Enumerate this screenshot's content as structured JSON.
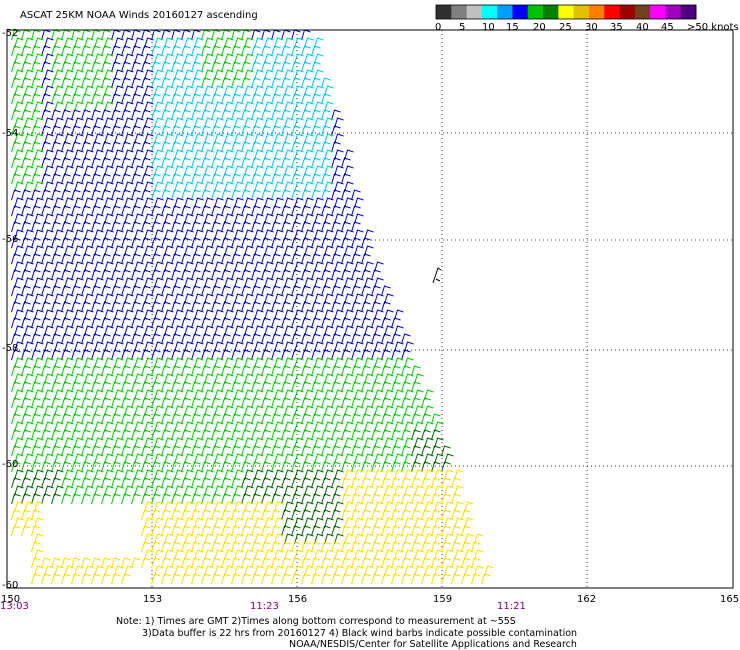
{
  "title": "ASCAT 25KM NOAA Winds 20160127 ascending",
  "colorbar": {
    "colors": [
      "#303030",
      "#808080",
      "#c0c0c0",
      "#00ffff",
      "#00a0ff",
      "#0000ff",
      "#00c000",
      "#008000",
      "#ffff00",
      "#e0c000",
      "#ff8000",
      "#ff0000",
      "#a00000",
      "#704020",
      "#ff00ff",
      "#a000c0",
      "#500080"
    ],
    "labels": [
      "0",
      "5",
      "10",
      "15",
      "20",
      "25",
      "30",
      "35",
      "40",
      "45",
      ">50 knots"
    ]
  },
  "axes": {
    "lon_ticks": [
      "150",
      "153",
      "156",
      "159",
      "162",
      "165"
    ],
    "lat_ticks": [
      "-52",
      "-54",
      "-56",
      "-58",
      "-60"
    ],
    "time_labels": [
      "13:03",
      "11:23",
      "11:21"
    ]
  },
  "wind_colors": {
    "light_blue": "#00c8e8",
    "blue": "#0000c8",
    "green": "#00c800",
    "dark_green": "#006400",
    "yellow": "#f0e000"
  },
  "notes": [
    "Note: 1) Times are GMT 2)Times along bottom correspond to measurement at ~55S",
    "3)Data buffer is 22 hrs from 20160127 4) Black wind barbs indicate possible contamination",
    "NOAA/NESDIS/Center for Satellite Applications and Research"
  ]
}
